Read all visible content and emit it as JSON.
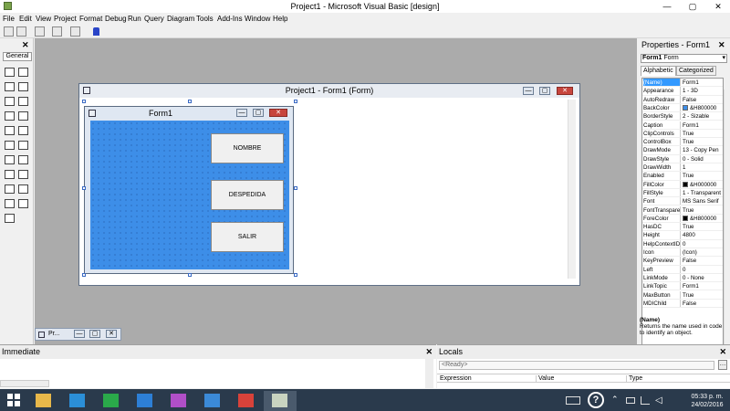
{
  "app": {
    "title": "Project1 - Microsoft Visual Basic [design]",
    "min_glyph": "—",
    "max_glyph": "▢",
    "close_glyph": "✕"
  },
  "menu": [
    "File",
    "Edit",
    "View",
    "Project",
    "Format",
    "Debug",
    "Run",
    "Query",
    "Diagram",
    "Tools",
    "Add-Ins",
    "Window",
    "Help"
  ],
  "toolbox": {
    "close_glyph": "✕",
    "tab_label": "General",
    "tool_icons": [
      "pointer-icon",
      "picturebox-icon",
      "label-icon",
      "textbox-icon",
      "frame-icon",
      "commandbutton-icon",
      "checkbox-icon",
      "optionbutton-icon",
      "combobox-icon",
      "listbox-icon",
      "hscrollbar-icon",
      "vscrollbar-icon",
      "timer-icon",
      "drivelistbox-icon",
      "dirlistbox-icon",
      "filelistbox-icon",
      "shape-icon",
      "line-icon",
      "image-icon",
      "data-icon",
      "ole-icon"
    ]
  },
  "project_window": {
    "title": "Project1 - Form1 (Form)"
  },
  "form": {
    "title": "Form1",
    "backcolor": "#3d8ee8",
    "buttons": [
      "NOMBRE",
      "DESPEDIDA",
      "SALIR"
    ]
  },
  "props": {
    "title": "Properties - Form1",
    "close_glyph": "✕",
    "object_name": "Form1",
    "object_type": "Form",
    "tabs": [
      "Alphabetic",
      "Categorized"
    ],
    "rows": [
      {
        "k": "(Name)",
        "v": "Form1"
      },
      {
        "k": "Appearance",
        "v": "1 - 3D"
      },
      {
        "k": "AutoRedraw",
        "v": "False"
      },
      {
        "k": "BackColor",
        "v": "&H800000",
        "swatch": "#3d8ee8"
      },
      {
        "k": "BorderStyle",
        "v": "2 - Sizable"
      },
      {
        "k": "Caption",
        "v": "Form1"
      },
      {
        "k": "ClipControls",
        "v": "True"
      },
      {
        "k": "ControlBox",
        "v": "True"
      },
      {
        "k": "DrawMode",
        "v": "13 - Copy Pen"
      },
      {
        "k": "DrawStyle",
        "v": "0 - Solid"
      },
      {
        "k": "DrawWidth",
        "v": "1"
      },
      {
        "k": "Enabled",
        "v": "True"
      },
      {
        "k": "FillColor",
        "v": "&H000000",
        "swatch": "#000000"
      },
      {
        "k": "FillStyle",
        "v": "1 - Transparent"
      },
      {
        "k": "Font",
        "v": "MS Sans Serif"
      },
      {
        "k": "FontTransparent",
        "v": "True"
      },
      {
        "k": "ForeColor",
        "v": "&H800000",
        "swatch": "#000000"
      },
      {
        "k": "HasDC",
        "v": "True"
      },
      {
        "k": "Height",
        "v": "4800"
      },
      {
        "k": "HelpContextID",
        "v": "0"
      },
      {
        "k": "Icon",
        "v": "(Icon)"
      },
      {
        "k": "KeyPreview",
        "v": "False"
      },
      {
        "k": "Left",
        "v": "0"
      },
      {
        "k": "LinkMode",
        "v": "0 - None"
      },
      {
        "k": "LinkTopic",
        "v": "Form1"
      },
      {
        "k": "MaxButton",
        "v": "True"
      },
      {
        "k": "MDIChild",
        "v": "False"
      }
    ],
    "desc_title": "(Name)",
    "desc_text": "Returns the name used in code to identify an object."
  },
  "project_minimized": {
    "label": "Pr..."
  },
  "immediate": {
    "title": "Immediate"
  },
  "locals": {
    "title": "Locals",
    "ready": "<Ready>",
    "columns": [
      "Expression",
      "Value",
      "Type"
    ]
  },
  "taskbar": {
    "time": "05:33 p. m.",
    "date": "24/02/2016",
    "apps": [
      {
        "name": "file-explorer-icon",
        "color": "#e8b84a"
      },
      {
        "name": "internet-explorer-icon",
        "color": "#2b8fd8"
      },
      {
        "name": "store-icon",
        "color": "#2aa94a"
      },
      {
        "name": "dropbox-icon",
        "color": "#2d7fd6"
      },
      {
        "name": "photos-app-icon",
        "color": "#b04fc8"
      },
      {
        "name": "remote-desktop-icon",
        "color": "#3b8ad8"
      },
      {
        "name": "chrome-icon",
        "color": "#d8423a"
      },
      {
        "name": "visual-basic-icon",
        "color": "#c9d4c0"
      }
    ]
  }
}
